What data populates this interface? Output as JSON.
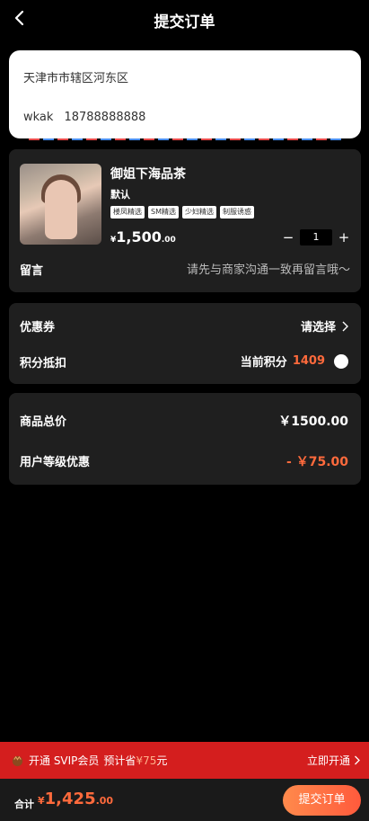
{
  "header": {
    "title": "提交订单"
  },
  "address": {
    "region": "天津市市辖区河东区",
    "name": "wkak",
    "phone": "18788888888"
  },
  "product": {
    "name": "御姐下海品茶",
    "spec": "默认",
    "tags": [
      "楼凤精选",
      "SM精选",
      "少妇精选",
      "制服诱惑"
    ],
    "price_currency": "¥",
    "price_int": "1,500",
    "price_dec": ".00",
    "quantity": "1",
    "minus": "−",
    "plus": "+"
  },
  "message": {
    "label": "留言",
    "hint": "请先与商家沟通一致再留言哦～"
  },
  "coupon": {
    "label": "优惠券",
    "action": "请选择"
  },
  "points": {
    "label": "积分抵扣",
    "prefix": "当前积分",
    "value": "1409"
  },
  "summary": {
    "goods_label": "商品总价",
    "goods_value": "￥1500.00",
    "discount_label": "用户等级优惠",
    "discount_value": "- ￥75.00"
  },
  "svip": {
    "open_text": "开通 SVIP会员",
    "save_text": "预计省",
    "save_amount": "¥75",
    "save_unit": "元",
    "action": "立即开通"
  },
  "footer": {
    "total_label": "合计",
    "currency": "¥",
    "total_int": "1,425",
    "total_dec": ".00",
    "submit_label": "提交订单"
  },
  "colors": {
    "accent": "#ff6a3c",
    "svip_bar": "#d41e1e",
    "card_bg": "#1f1f1f"
  }
}
